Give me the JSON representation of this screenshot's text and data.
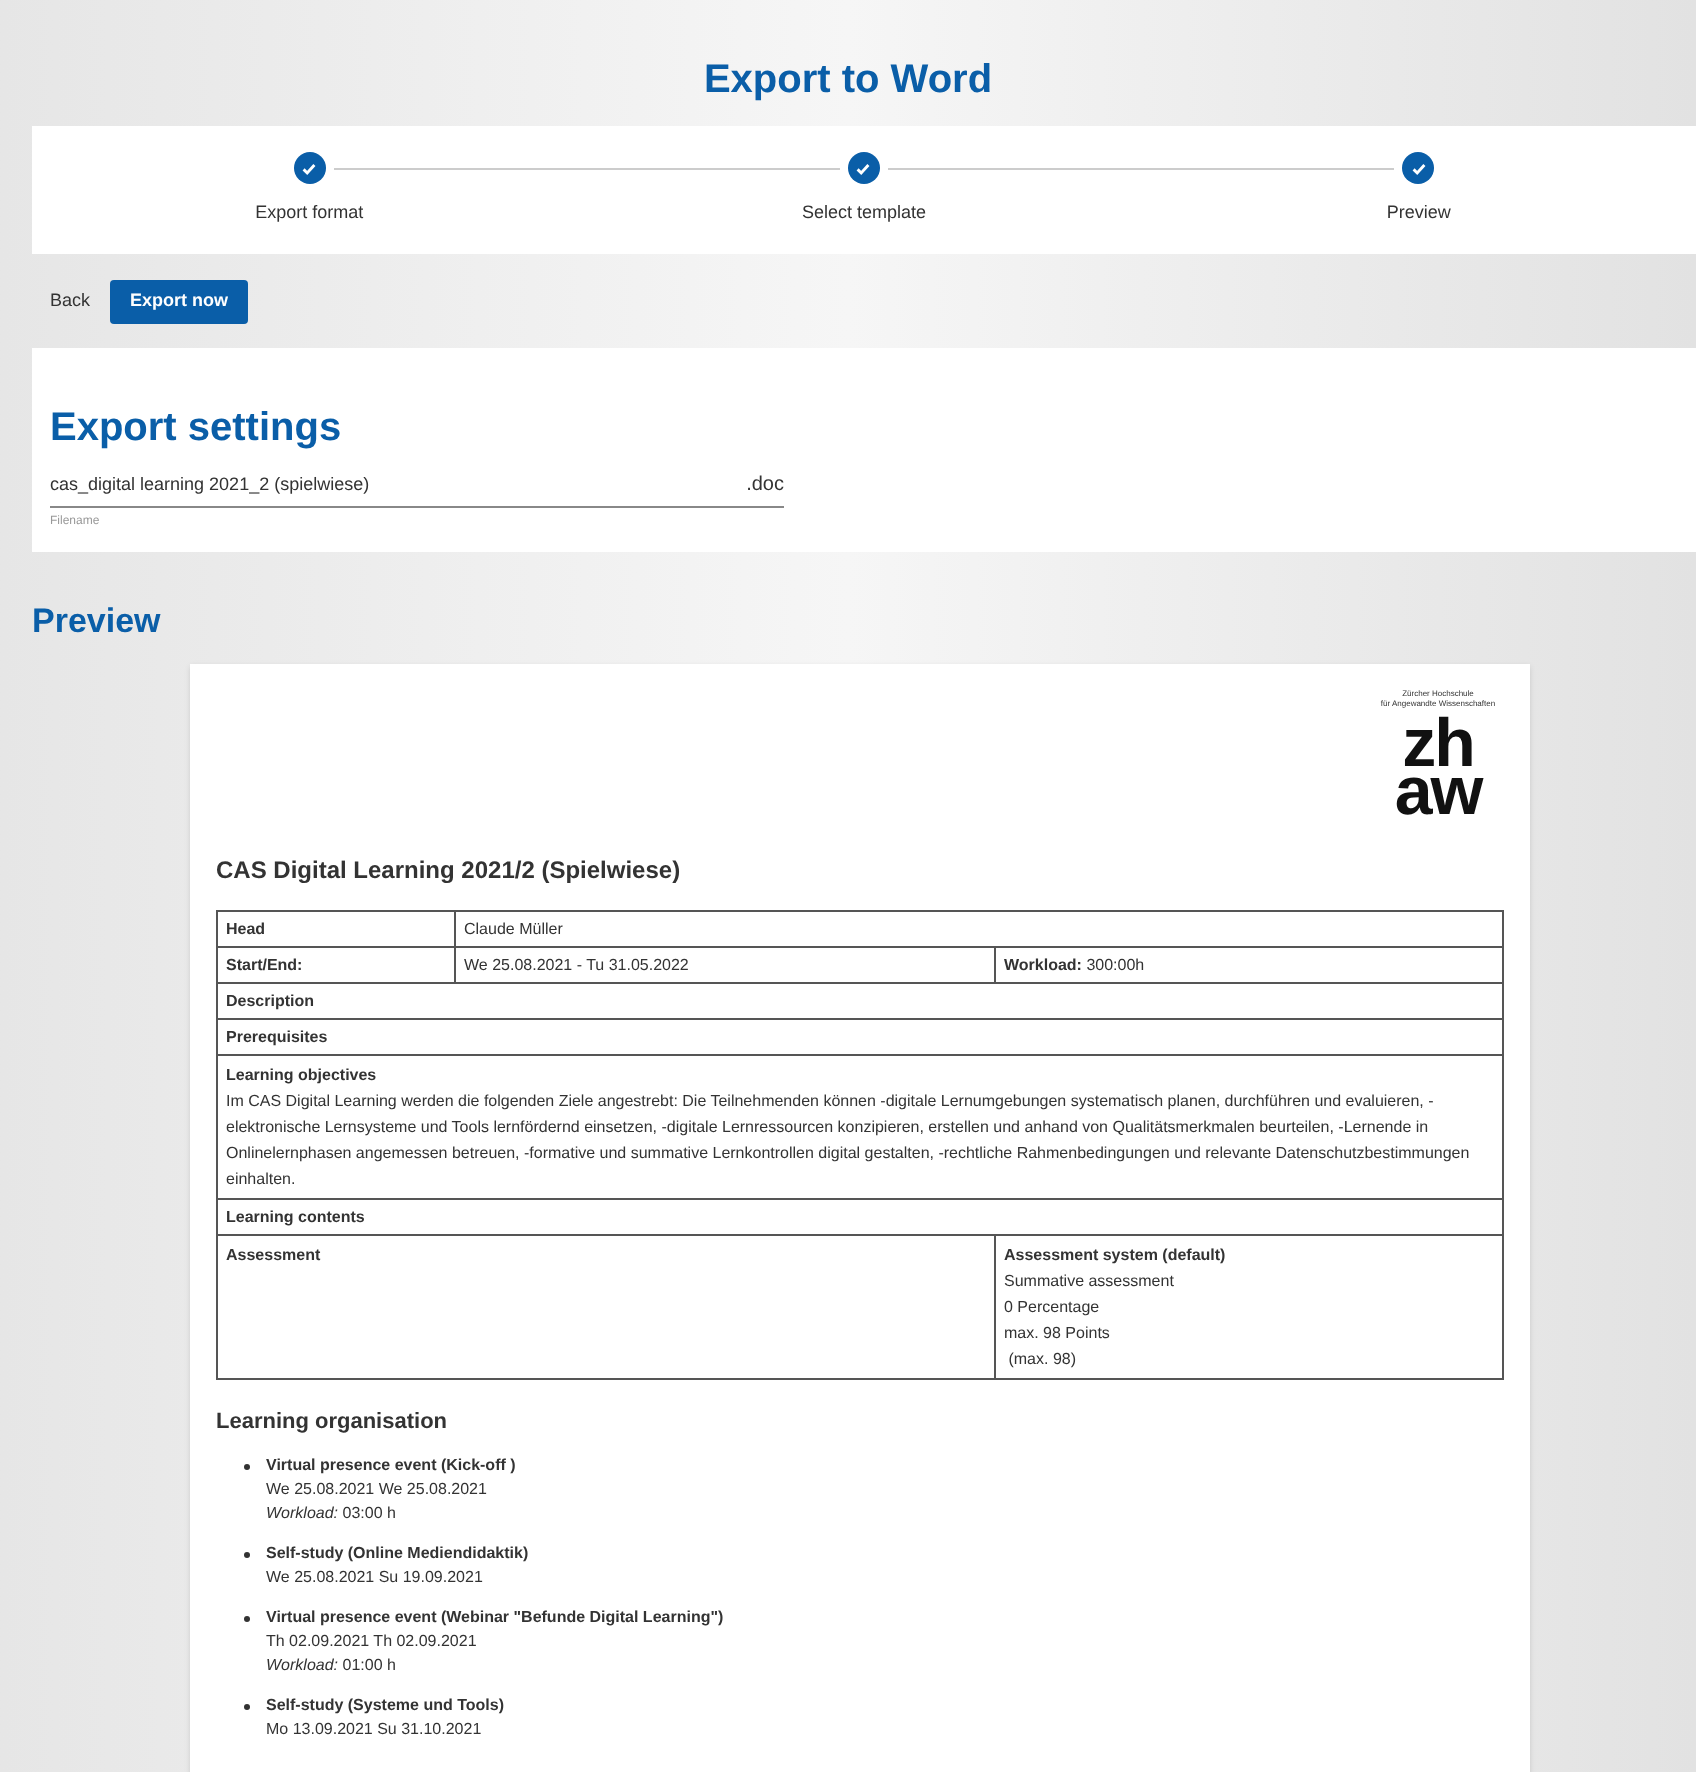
{
  "title": "Export to Word",
  "steps": [
    {
      "label": "Export format",
      "completed": true
    },
    {
      "label": "Select template",
      "completed": true
    },
    {
      "label": "Preview",
      "completed": true
    }
  ],
  "actions": {
    "back": "Back",
    "export": "Export now"
  },
  "settings": {
    "heading": "Export settings",
    "filename": "cas_digital learning 2021_2 (spielwiese)",
    "extension": ".doc",
    "field_label": "Filename"
  },
  "preview": {
    "heading": "Preview",
    "logo": {
      "line_1": "Zürcher Hochschule",
      "line_2": "für Angewandte Wissenschaften",
      "mark_top": "zh",
      "mark_bottom": "aw"
    },
    "doc_title": "CAS Digital Learning 2021/2 (Spielwiese)",
    "table": {
      "head_label": "Head",
      "head_value": "Claude Müller",
      "dates_label": "Start/End:",
      "dates_value": "We 25.08.2021 - Tu 31.05.2022",
      "workload_label": "Workload:",
      "workload_value": "300:00h",
      "description": "Description",
      "prerequisites": "Prerequisites",
      "objectives_label": "Learning objectives",
      "objectives_text": "Im CAS Digital Learning werden die folgenden Ziele angestrebt: Die Teilnehmenden können -digitale Lernumgebungen systematisch planen, durchführen und evaluieren, -elektronische Lernsysteme und Tools lernfördernd einsetzen, -digitale Lernressourcen konzipieren, erstellen und anhand von Qualitätsmerkmalen beurteilen, -Lernende in Onlinelernphasen angemessen betreuen, -formative und summative Lernkontrollen digital gestalten, -rechtliche Rahmenbedingungen und relevante Datenschutzbestimmungen einhalten.",
      "contents": "Learning contents",
      "assessment": "Assessment",
      "system_label": "Assessment system (default)",
      "system_lines": [
        "Summative assessment",
        "0 Percentage",
        "max. 98 Points",
        " (max. 98)"
      ]
    },
    "organisation_heading": "Learning organisation",
    "organisation": [
      {
        "title": "Virtual presence event (Kick-off )",
        "dates": "We 25.08.2021 We 25.08.2021",
        "workload_label": "Workload:",
        "workload": "03:00 h"
      },
      {
        "title": "Self-study (Online Mediendidaktik)",
        "dates": "We 25.08.2021 Su 19.09.2021"
      },
      {
        "title": "Virtual presence event (Webinar \"Befunde Digital Learning\")",
        "dates": "Th 02.09.2021 Th 02.09.2021",
        "workload_label": "Workload:",
        "workload": "01:00 h"
      },
      {
        "title": "Self-study (Systeme und Tools)",
        "dates": "Mo 13.09.2021 Su 31.10.2021"
      }
    ]
  }
}
